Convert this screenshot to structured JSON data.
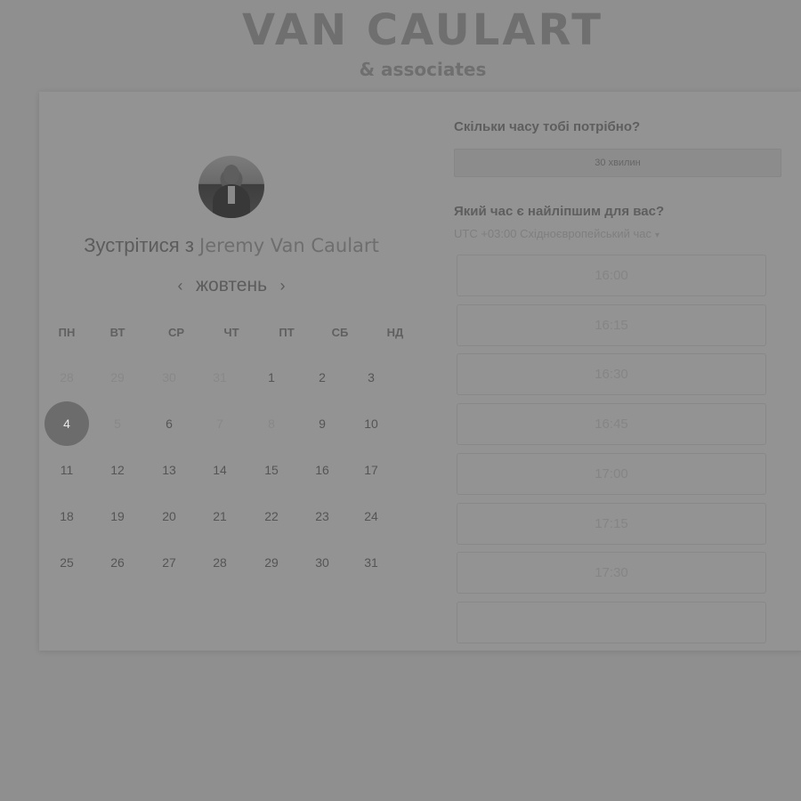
{
  "logo": {
    "main": "VAN CAULART",
    "sub": "& associates"
  },
  "host": {
    "title_prefix": "Зустрітися з",
    "name": "Jeremy Van Caulart"
  },
  "calendar": {
    "month": "жовтень",
    "prev_icon": "chevron-left-icon",
    "next_icon": "chevron-right-icon",
    "prev_glyph": "‹",
    "next_glyph": "›",
    "weekdays": [
      "ПН",
      "ВТ",
      "СР",
      "ЧТ",
      "ПТ",
      "СБ",
      "НД"
    ],
    "weeks": [
      [
        "28",
        "29",
        "30",
        "31",
        "1",
        "2",
        "3"
      ],
      [
        "4",
        "5",
        "6",
        "7",
        "8",
        "9",
        "10"
      ],
      [
        "11",
        "12",
        "13",
        "14",
        "15",
        "16",
        "17"
      ],
      [
        "18",
        "19",
        "20",
        "21",
        "22",
        "23",
        "24"
      ],
      [
        "25",
        "26",
        "27",
        "28",
        "29",
        "30",
        "31"
      ]
    ],
    "muted": [
      [
        true,
        true,
        true,
        true,
        false,
        false,
        false
      ],
      [
        false,
        true,
        false,
        true,
        true,
        false,
        false
      ],
      [
        false,
        false,
        false,
        false,
        false,
        false,
        false
      ],
      [
        false,
        false,
        false,
        false,
        false,
        false,
        false
      ],
      [
        false,
        false,
        false,
        false,
        false,
        false,
        false
      ]
    ],
    "selected": "4"
  },
  "booking": {
    "duration_question": "Скільки часу тобі потрібно?",
    "duration_value": "30 хвилин",
    "time_question": "Який час є найліпшим для вас?",
    "timezone": "UTC +03:00 Східноєвропейський час",
    "timezone_caret": "▾",
    "slots": [
      "16:00",
      "16:15",
      "16:30",
      "16:45",
      "17:00",
      "17:15",
      "17:30",
      ""
    ]
  }
}
